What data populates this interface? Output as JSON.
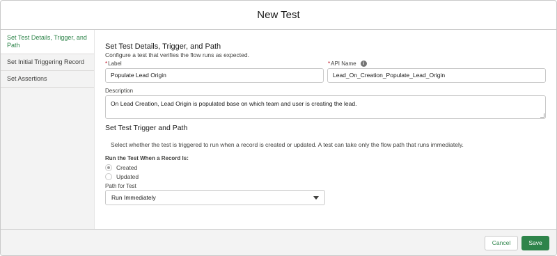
{
  "modal": {
    "title": "New Test"
  },
  "sidebar": {
    "items": [
      {
        "label": "Set Test Details, Trigger, and Path",
        "active": true
      },
      {
        "label": "Set Initial Triggering Record",
        "active": false
      },
      {
        "label": "Set Assertions",
        "active": false
      }
    ]
  },
  "section1": {
    "title": "Set Test Details, Trigger, and Path",
    "subtitle": "Configure a test that verifies the flow runs as expected.",
    "label_field": {
      "label": "Label",
      "required_marker": "*",
      "value": "Populate Lead Origin"
    },
    "api_field": {
      "label": "API Name",
      "required_marker": "*",
      "value": "Lead_On_Creation_Populate_Lead_Origin",
      "icon": "info-icon"
    },
    "description": {
      "label": "Description",
      "value": "On Lead Creation,  Lead Origin is populated base on which team and user is creating the lead."
    }
  },
  "section2": {
    "title": "Set Test Trigger and Path",
    "description": "Select whether the test is triggered to run when a record is created or updated. A test can take only the flow path that runs immediately.",
    "run_when_label": "Run the Test When a Record Is:",
    "options": [
      {
        "label": "Created",
        "checked": true
      },
      {
        "label": "Updated",
        "checked": false
      }
    ],
    "path_label": "Path for Test",
    "path_value": "Run Immediately"
  },
  "footer": {
    "cancel_label": "Cancel",
    "save_label": "Save"
  },
  "colors": {
    "accent": "#2e844a",
    "required": "#ba0517",
    "border": "#c9c9c9"
  }
}
